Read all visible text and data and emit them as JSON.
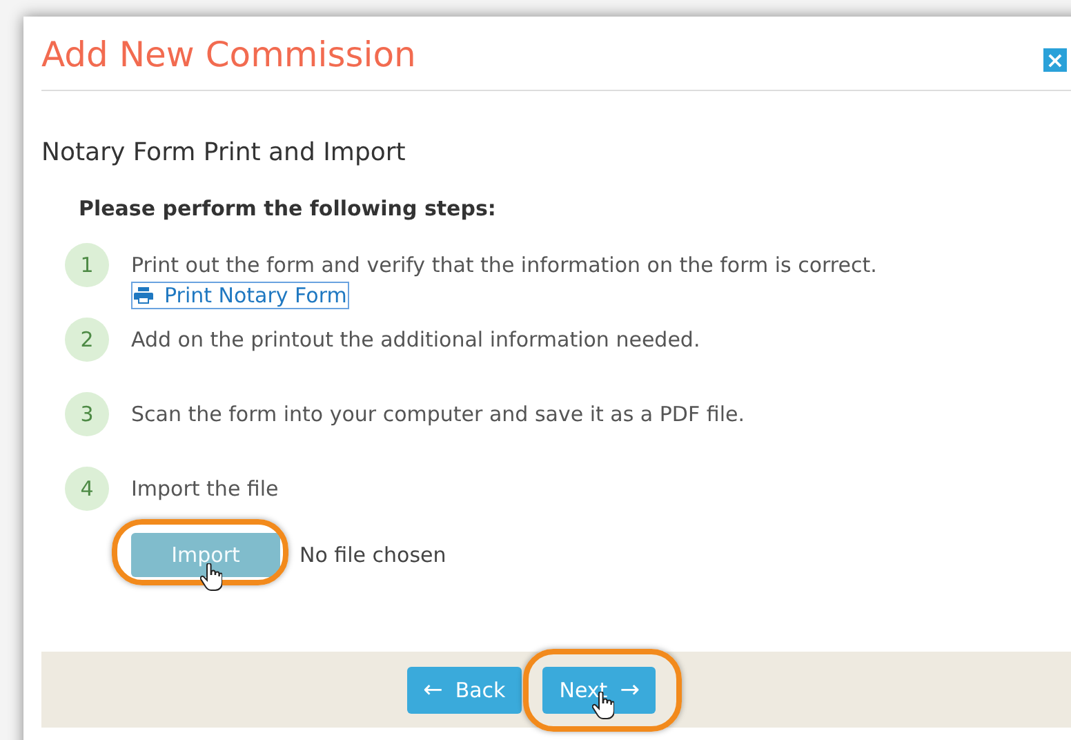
{
  "dialog": {
    "title": "Add New Commission",
    "close": "×"
  },
  "section_title": "Notary Form Print and Import",
  "instructions": "Please perform the following steps:",
  "steps": [
    {
      "number": "1",
      "text": "Print out the form and verify that the information on the form is correct.",
      "link": "Print Notary Form"
    },
    {
      "number": "2",
      "text": "Add on the printout the additional information needed."
    },
    {
      "number": "3",
      "text": "Scan the form into your computer and save it as a PDF file."
    },
    {
      "number": "4",
      "text": "Import the file"
    }
  ],
  "file_input": {
    "button": "Import",
    "status": "No file chosen",
    "highlighted": true
  },
  "footer": {
    "buttons": [
      {
        "label": "Back",
        "arrow": "←",
        "kind": "back",
        "highlighted": false
      },
      {
        "label": "Next",
        "arrow": "→",
        "kind": "next",
        "highlighted": true
      }
    ]
  }
}
